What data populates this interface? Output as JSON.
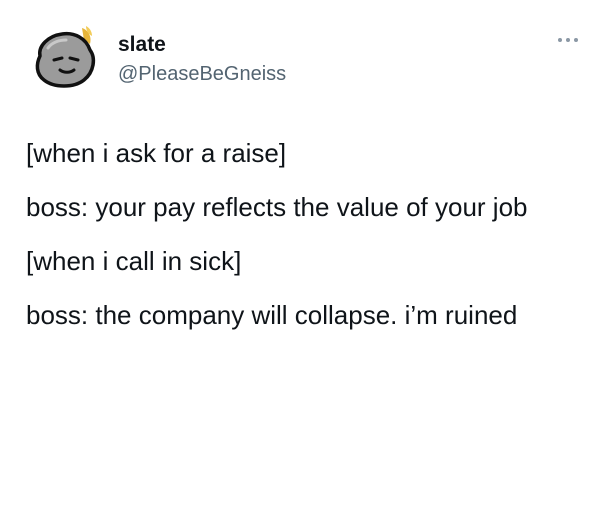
{
  "author": {
    "display_name": "slate",
    "handle": "@PleaseBeGneiss",
    "avatar_icon": "rock-face-avatar"
  },
  "menu": {
    "icon": "more-options-icon"
  },
  "tweet": {
    "lines": [
      "[when i ask for a raise]",
      "boss: your pay reflects the value of your job",
      "[when i call in sick]",
      "boss: the company will collapse. i’m ruined"
    ]
  },
  "colors": {
    "text": "#0f1419",
    "secondary": "#536471",
    "background": "#ffffff"
  }
}
